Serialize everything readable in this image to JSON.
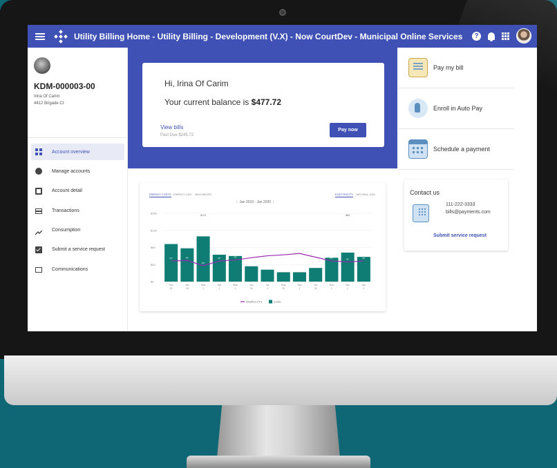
{
  "topbar": {
    "title": "Utility Billing Home - Utility Billing - Development (V.X) - Now CourtDev - Municipal Online Services",
    "help_glyph": "?"
  },
  "account": {
    "number": "KDM-000003-00",
    "name": "Irina Of Carim",
    "address": "4412 Brigade Ct"
  },
  "sidebar": {
    "items": [
      {
        "label": "Account overview",
        "icon": "dashboard-icon",
        "active": true
      },
      {
        "label": "Manage accounts",
        "icon": "account-circle-icon",
        "active": false
      },
      {
        "label": "Account detail",
        "icon": "wallet-icon",
        "active": false
      },
      {
        "label": "Transactions",
        "icon": "credit-card-icon",
        "active": false
      },
      {
        "label": "Consumption",
        "icon": "trending-up-icon",
        "active": false
      },
      {
        "label": "Submit a service request",
        "icon": "checkbox-icon",
        "active": false
      },
      {
        "label": "Communications",
        "icon": "mail-icon",
        "active": false
      }
    ]
  },
  "balance": {
    "greeting": "Hi, Irina Of Carim",
    "prefix": "Your current balance is ",
    "amount": "$477.72",
    "view_bills": "View bills",
    "past_due": "Past Due $245.72",
    "pay_now": "Pay now"
  },
  "actions": [
    {
      "label": "Pay my bill",
      "icon": "bill-icon"
    },
    {
      "label": "Enroll in Auto Pay",
      "icon": "touch-icon"
    },
    {
      "label": "Schedule a payment",
      "icon": "calendar-icon"
    }
  ],
  "chart_tabs": {
    "left": [
      "ENERGY COSTS",
      "ENERGY USE",
      "NEIGHBORS"
    ],
    "right": [
      "ELECTRICITY",
      "NATURAL GAS"
    ]
  },
  "chart_data": {
    "type": "bar",
    "date_range": "Jan 2019 - Jan 2020",
    "categories": [
      "Dec 31",
      "Jan 30",
      "Mar 1",
      "Apr 1",
      "May 1",
      "Jun 31",
      "Jul 1",
      "Aug 31",
      "Sep 1",
      "Oct 31",
      "Nov 1",
      "Dec 2",
      "Jan 2"
    ],
    "series": [
      {
        "name": "Costs",
        "values": [
          88,
          78,
          106,
          63,
          60,
          36,
          28,
          22,
          22,
          32,
          56,
          68,
          58
        ],
        "color": "#0f7d74"
      },
      {
        "name": "Weather (°F)",
        "values": [
          44,
          45,
          34,
          44,
          46,
          51,
          55,
          57,
          60,
          52,
          44,
          42,
          44
        ],
        "color": "#9c27b0"
      }
    ],
    "yticks": [
      "$0",
      "$40",
      "$80",
      "$120",
      "$160"
    ],
    "ylim": [
      0,
      160
    ],
    "peak_labels": [
      "$123",
      "$89"
    ]
  },
  "contact": {
    "title": "Contact us",
    "phone": "111-222-3333",
    "email": "bills@payments.com",
    "submit": "Submit service request"
  }
}
